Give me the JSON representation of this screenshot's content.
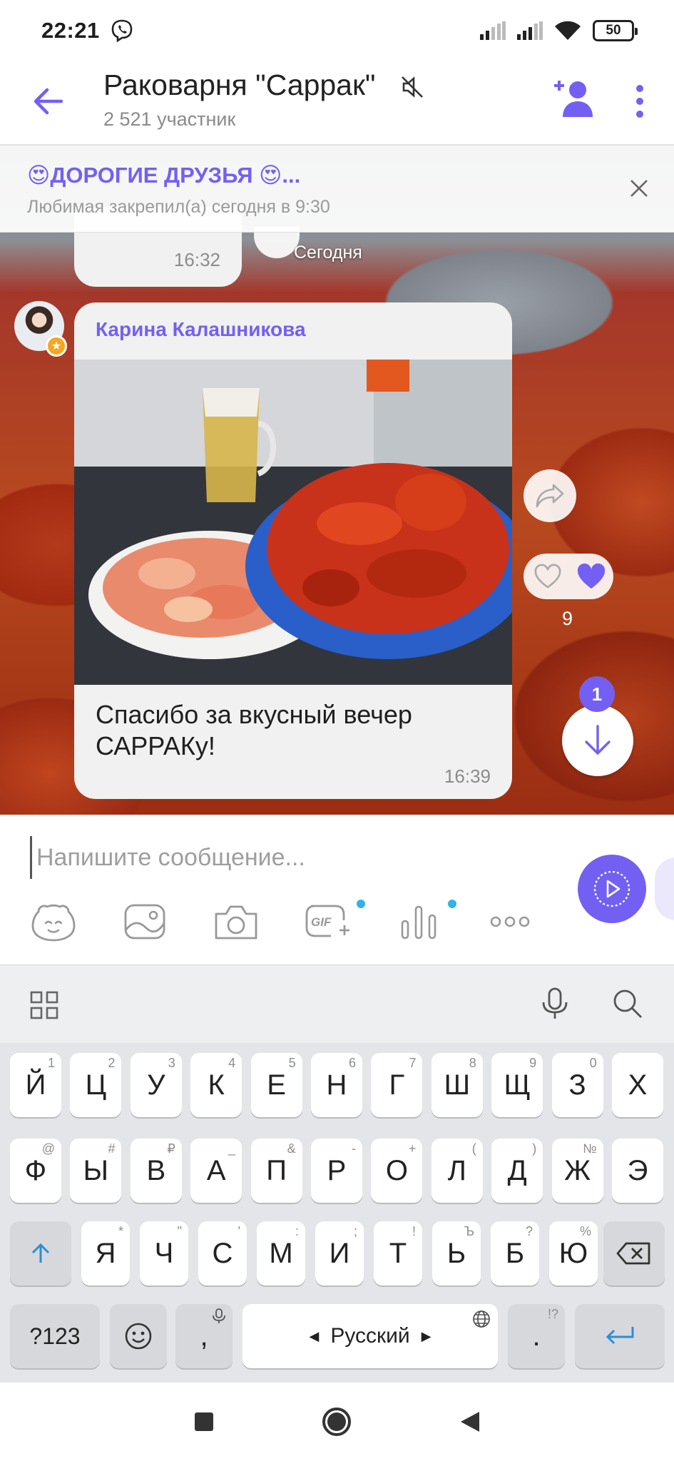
{
  "status": {
    "time": "22:21",
    "battery": "50"
  },
  "header": {
    "title": "Раковарня \"Саррак\"",
    "subtitle": "2 521 участник"
  },
  "pinned": {
    "title": "😍ДОРОГИЕ ДРУЗЬЯ 😍...",
    "subtitle": "Любимая закрепил(а) сегодня в 9:30"
  },
  "chat": {
    "prev_time": "16:32",
    "date_label": "Сегодня",
    "message": {
      "sender": "Карина Калашникова",
      "text": "Спасибо за вкусный вечер САРРАКу!",
      "time": "16:39",
      "like_count": "9"
    },
    "unread_count": "1"
  },
  "composer": {
    "placeholder": "Напишите сообщение..."
  },
  "keyboard": {
    "row1": [
      {
        "k": "Й",
        "s": "1"
      },
      {
        "k": "Ц",
        "s": "2"
      },
      {
        "k": "У",
        "s": "3"
      },
      {
        "k": "К",
        "s": "4"
      },
      {
        "k": "Е",
        "s": "5"
      },
      {
        "k": "Н",
        "s": "6"
      },
      {
        "k": "Г",
        "s": "7"
      },
      {
        "k": "Ш",
        "s": "8"
      },
      {
        "k": "Щ",
        "s": "9"
      },
      {
        "k": "З",
        "s": "0"
      },
      {
        "k": "Х",
        "s": ""
      }
    ],
    "row2": [
      {
        "k": "Ф",
        "s": "@"
      },
      {
        "k": "Ы",
        "s": "#"
      },
      {
        "k": "В",
        "s": "₽"
      },
      {
        "k": "А",
        "s": "_"
      },
      {
        "k": "П",
        "s": "&"
      },
      {
        "k": "Р",
        "s": "-"
      },
      {
        "k": "О",
        "s": "+"
      },
      {
        "k": "Л",
        "s": "("
      },
      {
        "k": "Д",
        "s": ")"
      },
      {
        "k": "Ж",
        "s": "№"
      },
      {
        "k": "Э",
        "s": ""
      }
    ],
    "row3": [
      {
        "k": "Я",
        "s": "*"
      },
      {
        "k": "Ч",
        "s": "\""
      },
      {
        "k": "С",
        "s": "'"
      },
      {
        "k": "М",
        "s": ":"
      },
      {
        "k": "И",
        "s": ";"
      },
      {
        "k": "Т",
        "s": "!"
      },
      {
        "k": "Ь",
        "s": "Ъ"
      },
      {
        "k": "Б",
        "s": "?"
      },
      {
        "k": "Ю",
        "s": "%"
      }
    ],
    "num_label": "?123",
    "comma": ",",
    "space_label": "Русский",
    "period": ".",
    "period_sup": "!?"
  },
  "colors": {
    "accent": "#7360f2",
    "dot": "#2fb3e8"
  }
}
